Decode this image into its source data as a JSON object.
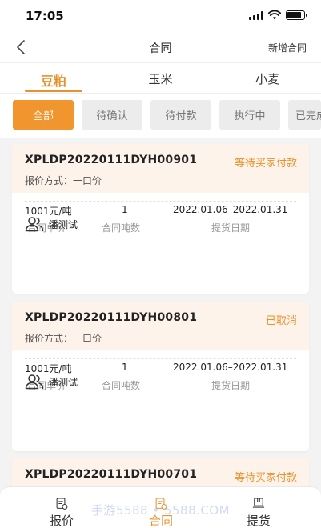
{
  "status_bar": {
    "time": "17:05"
  },
  "nav": {
    "title": "合同",
    "action": "新增合同"
  },
  "categories": [
    {
      "label": "豆粕",
      "active": true
    },
    {
      "label": "玉米",
      "active": false
    },
    {
      "label": "小麦",
      "active": false
    }
  ],
  "filters": [
    {
      "label": "全部",
      "active": true
    },
    {
      "label": "待确认",
      "active": false
    },
    {
      "label": "待付款",
      "active": false
    },
    {
      "label": "执行中",
      "active": false
    },
    {
      "label": "已完成",
      "active": false
    }
  ],
  "contracts": [
    {
      "order_no": "XPLDP20220111DYH00901",
      "status": "等待买家付款",
      "quote_method": "报价方式：一口价",
      "unit_price": "1001元/吨",
      "unit_price_label": "合同单价",
      "tonnage": "1",
      "tonnage_label": "合同吨数",
      "pickup_date": "2022.01.06–2022.01.31",
      "pickup_date_label": "提货日期",
      "person": "潘测试"
    },
    {
      "order_no": "XPLDP20220111DYH00801",
      "status": "已取消",
      "quote_method": "报价方式：一口价",
      "unit_price": "1001元/吨",
      "unit_price_label": "合同单价",
      "tonnage": "1",
      "tonnage_label": "合同吨数",
      "pickup_date": "2022.01.06–2022.01.31",
      "pickup_date_label": "提货日期",
      "person": "潘测试"
    },
    {
      "order_no": "XPLDP20220111DYH00701",
      "status": "等待买家付款"
    }
  ],
  "bottom_nav": [
    {
      "label": "报价",
      "icon": "quote-document-icon",
      "active": false
    },
    {
      "label": "合同",
      "icon": "contract-document-icon",
      "active": true
    },
    {
      "label": "提货",
      "icon": "pickup-box-icon",
      "active": false
    }
  ],
  "watermark": "手游5588 • 5588.COM",
  "colors": {
    "accent": "#e8922e",
    "card_head": "#fdf3ea",
    "chip_bg": "#ececec"
  }
}
